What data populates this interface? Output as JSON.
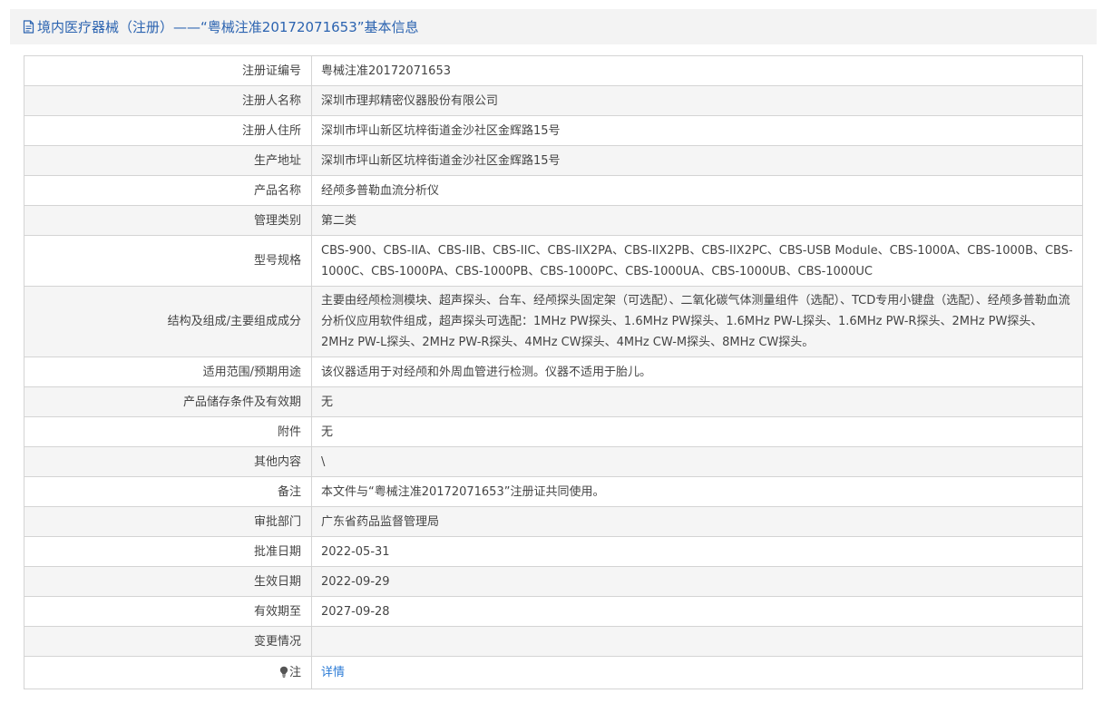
{
  "header": {
    "title": "境内医疗器械（注册）——“粤械注准20172071653”基本信息",
    "icon": "document-icon"
  },
  "rows": [
    {
      "label": "注册证编号",
      "value": "粤械注准20172071653"
    },
    {
      "label": "注册人名称",
      "value": "深圳市理邦精密仪器股份有限公司"
    },
    {
      "label": "注册人住所",
      "value": "深圳市坪山新区坑梓街道金沙社区金辉路15号"
    },
    {
      "label": "生产地址",
      "value": "深圳市坪山新区坑梓街道金沙社区金辉路15号"
    },
    {
      "label": "产品名称",
      "value": "经颅多普勒血流分析仪"
    },
    {
      "label": "管理类别",
      "value": "第二类"
    },
    {
      "label": "型号规格",
      "value": "CBS-900、CBS-IIA、CBS-IIB、CBS-IIC、CBS-IIX2PA、CBS-IIX2PB、CBS-IIX2PC、CBS-USB Module、CBS-1000A、CBS-1000B、CBS-1000C、CBS-1000PA、CBS-1000PB、CBS-1000PC、CBS-1000UA、CBS-1000UB、CBS-1000UC"
    },
    {
      "label": "结构及组成/主要组成成分",
      "value": "主要由经颅检测模块、超声探头、台车、经颅探头固定架（可选配）、二氧化碳气体测量组件（选配）、TCD专用小键盘（选配）、经颅多普勒血流分析仪应用软件组成，超声探头可选配：1MHz PW探头、1.6MHz PW探头、1.6MHz PW-L探头、1.6MHz PW-R探头、2MHz PW探头、2MHz PW-L探头、2MHz PW-R探头、4MHz CW探头、4MHz CW-M探头、8MHz CW探头。"
    },
    {
      "label": "适用范围/预期用途",
      "value": "该仪器适用于对经颅和外周血管进行检测。仪器不适用于胎儿。"
    },
    {
      "label": "产品储存条件及有效期",
      "value": "无"
    },
    {
      "label": "附件",
      "value": "无"
    },
    {
      "label": "其他内容",
      "value": "\\"
    },
    {
      "label": "备注",
      "value": "本文件与“粤械注准20172071653”注册证共同使用。"
    },
    {
      "label": "审批部门",
      "value": "广东省药品监督管理局"
    },
    {
      "label": "批准日期",
      "value": "2022-05-31"
    },
    {
      "label": "生效日期",
      "value": "2022-09-29"
    },
    {
      "label": "有效期至",
      "value": "2027-09-28"
    },
    {
      "label": "变更情况",
      "value": ""
    }
  ],
  "note_row": {
    "icon": "lightbulb-icon",
    "label": "注",
    "link_text": "详情"
  },
  "colors": {
    "title": "#2b63b0",
    "link": "#2b7bd6",
    "border": "#d4d4d4",
    "stripe": "#f5f5f5",
    "header_bg": "#f3f3f3"
  }
}
